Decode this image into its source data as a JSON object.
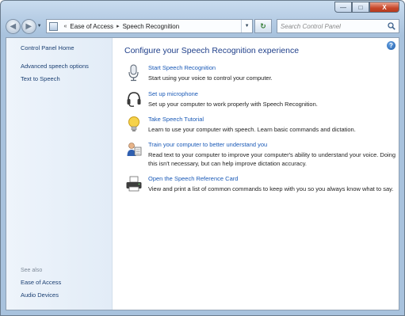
{
  "window": {
    "caption": {
      "minimize": "—",
      "maximize": "□",
      "close": "X"
    }
  },
  "nav": {
    "breadcrumb_overflow": "«",
    "breadcrumb": [
      "Ease of Access",
      "Speech Recognition"
    ],
    "separator": "▸",
    "refresh": "↻",
    "search_placeholder": "Search Control Panel"
  },
  "sidebar": {
    "home": "Control Panel Home",
    "links": [
      "Advanced speech options",
      "Text to Speech"
    ],
    "see_also_label": "See also",
    "see_also": [
      "Ease of Access",
      "Audio Devices"
    ]
  },
  "main": {
    "title": "Configure your Speech Recognition experience",
    "help": "?",
    "tasks": [
      {
        "icon": "microphone-icon",
        "link": "Start Speech Recognition",
        "desc": "Start using your voice to control your computer."
      },
      {
        "icon": "headset-icon",
        "link": "Set up microphone",
        "desc": "Set up your computer to work properly with Speech Recognition."
      },
      {
        "icon": "lightbulb-icon",
        "link": "Take Speech Tutorial",
        "desc": "Learn to use your computer with speech.  Learn basic commands and dictation."
      },
      {
        "icon": "user-train-icon",
        "link": "Train your computer to better understand you",
        "desc": "Read text to your computer to improve your computer's ability to understand your voice.  Doing this isn't necessary, but can help improve dictation accuracy."
      },
      {
        "icon": "printer-icon",
        "link": "Open the Speech Reference Card",
        "desc": "View and print a list of common commands to keep with you so you always know what to say."
      }
    ]
  }
}
